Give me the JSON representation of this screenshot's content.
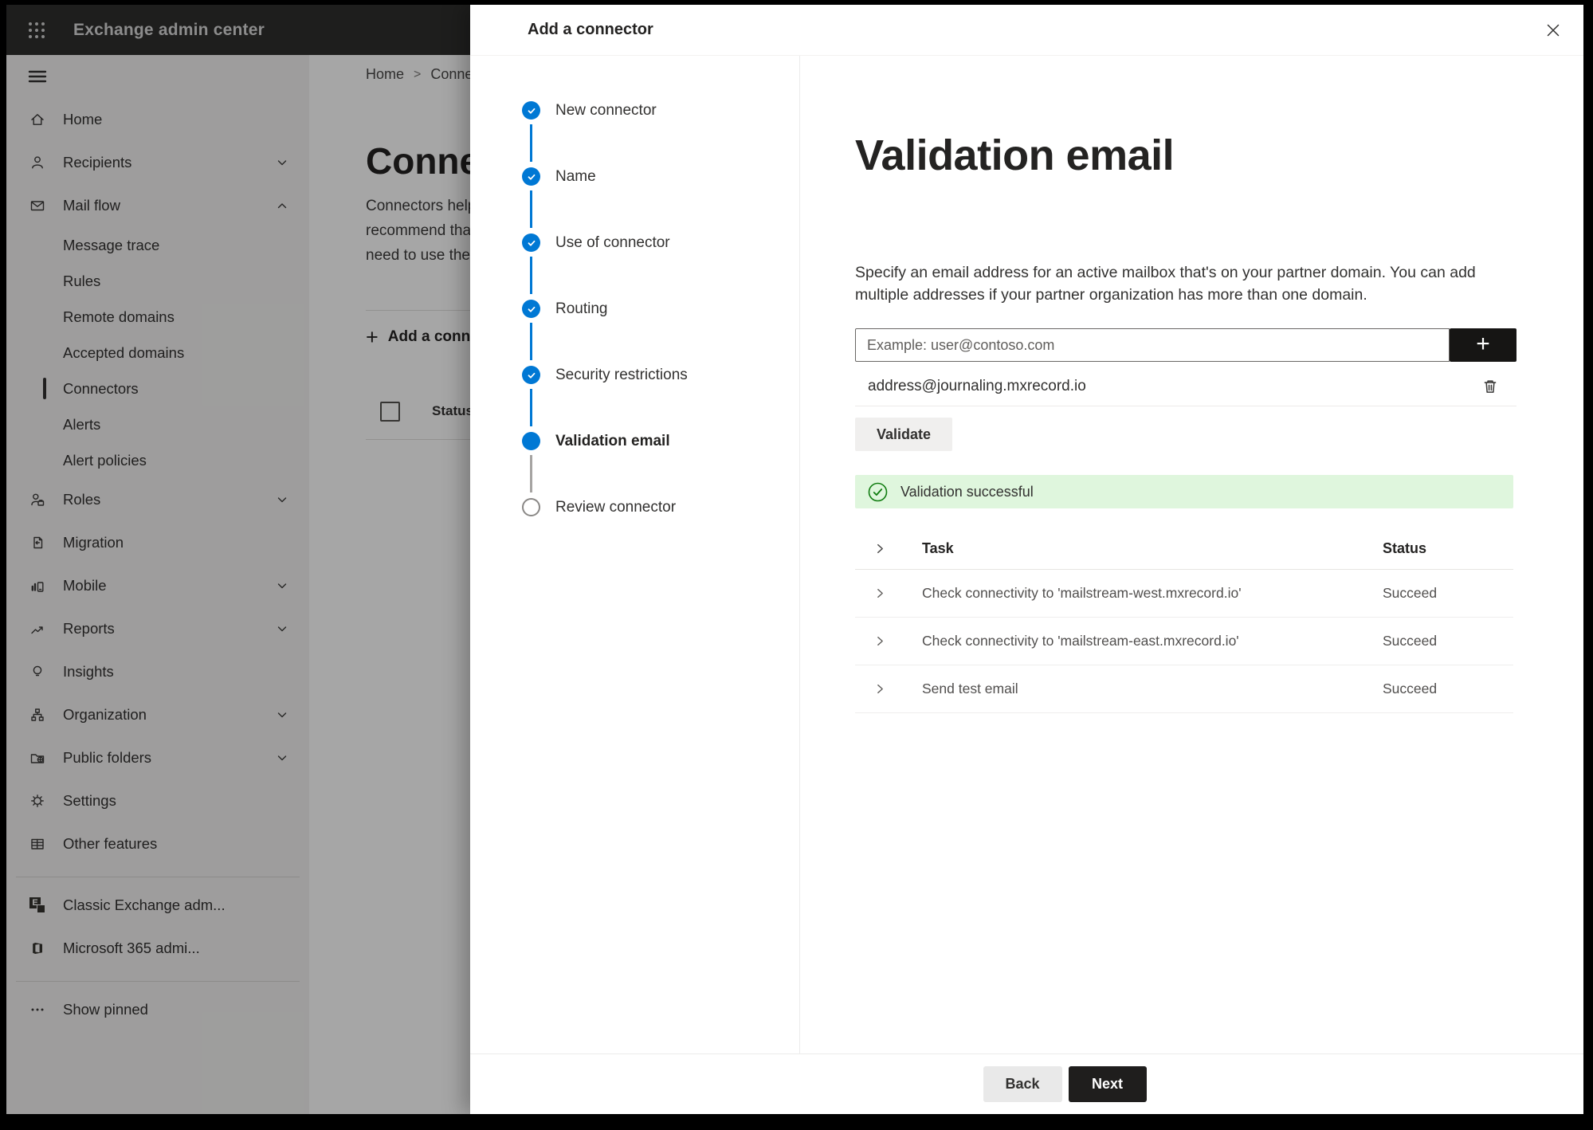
{
  "colors": {
    "accent_blue": "#0078d4",
    "success_bg": "#dff6dd",
    "success_green": "#107c10",
    "topbar_bg": "#2f2e2d",
    "sidebar_bg": "#f3f2f1",
    "dark_button": "#1f1e1d"
  },
  "topbar": {
    "title": "Exchange admin center"
  },
  "sidebar": {
    "items": [
      {
        "label": "Home"
      },
      {
        "label": "Recipients"
      },
      {
        "label": "Mail flow"
      },
      {
        "label": "Message trace"
      },
      {
        "label": "Rules"
      },
      {
        "label": "Remote domains"
      },
      {
        "label": "Accepted domains"
      },
      {
        "label": "Connectors"
      },
      {
        "label": "Alerts"
      },
      {
        "label": "Alert policies"
      },
      {
        "label": "Roles"
      },
      {
        "label": "Migration"
      },
      {
        "label": "Mobile"
      },
      {
        "label": "Reports"
      },
      {
        "label": "Insights"
      },
      {
        "label": "Organization"
      },
      {
        "label": "Public folders"
      },
      {
        "label": "Settings"
      },
      {
        "label": "Other features"
      },
      {
        "label": "Classic Exchange adm..."
      },
      {
        "label": "Microsoft 365 admi..."
      },
      {
        "label": "Show pinned"
      }
    ]
  },
  "background": {
    "breadcrumb": {
      "home": "Home",
      "current": "Connectors"
    },
    "page_title": "Connectors",
    "intro_lines": [
      "Connectors help control the flow of email messages to and",
      "recommend that you don't use them unless you know you",
      "need to use them. Learn more about connectors"
    ],
    "add_button": "Add a connector",
    "column_header": "Status"
  },
  "panel": {
    "title": "Add a connector",
    "steps": [
      {
        "label": "New connector",
        "state": "done"
      },
      {
        "label": "Name",
        "state": "done"
      },
      {
        "label": "Use of connector",
        "state": "done"
      },
      {
        "label": "Routing",
        "state": "done"
      },
      {
        "label": "Security restrictions",
        "state": "done"
      },
      {
        "label": "Validation email",
        "state": "current"
      },
      {
        "label": "Review connector",
        "state": "todo"
      }
    ],
    "heading": "Validation email",
    "description": "Specify an email address for an active mailbox that's on your partner domain. You can add multiple addresses if your partner organization has more than one domain.",
    "email_input": {
      "placeholder": "Example: user@contoso.com",
      "value": ""
    },
    "added_address": "address@journaling.mxrecord.io",
    "validate_button": "Validate",
    "banner": "Validation successful",
    "table": {
      "task_header": "Task",
      "status_header": "Status",
      "rows": [
        {
          "task": "Check connectivity to 'mailstream-west.mxrecord.io'",
          "status": "Succeed"
        },
        {
          "task": "Check connectivity to 'mailstream-east.mxrecord.io'",
          "status": "Succeed"
        },
        {
          "task": "Send test email",
          "status": "Succeed"
        }
      ]
    },
    "back_button": "Back",
    "next_button": "Next"
  }
}
